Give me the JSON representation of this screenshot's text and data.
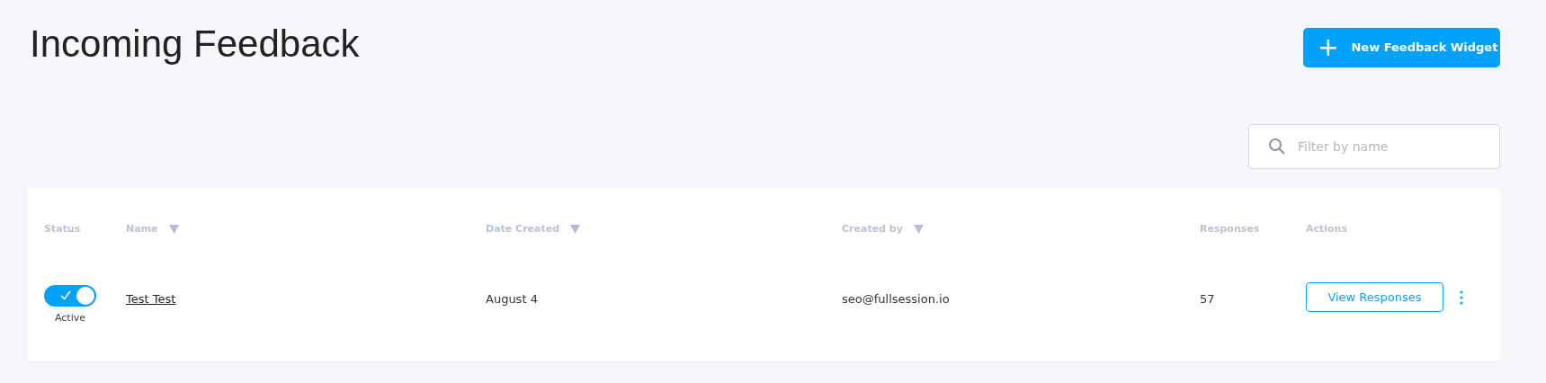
{
  "page_title": "Incoming Feedback",
  "new_button": {
    "label": "New Feedback Widget",
    "icon": "+"
  },
  "search": {
    "placeholder": "Filter by name"
  },
  "table": {
    "columns": [
      {
        "label": "Status",
        "sortable": false
      },
      {
        "label": "Name",
        "sortable": true
      },
      {
        "label": "Date Created",
        "sortable": true
      },
      {
        "label": "Created by",
        "sortable": true
      },
      {
        "label": "Responses",
        "sortable": false
      },
      {
        "label": "Actions",
        "sortable": false
      }
    ],
    "rows": [
      {
        "active": true,
        "status_label": "Active",
        "name": "Test Test",
        "date_created": "August 4",
        "created_by": "seo@fullsession.io",
        "responses": "57",
        "action": "View Responses"
      }
    ]
  }
}
